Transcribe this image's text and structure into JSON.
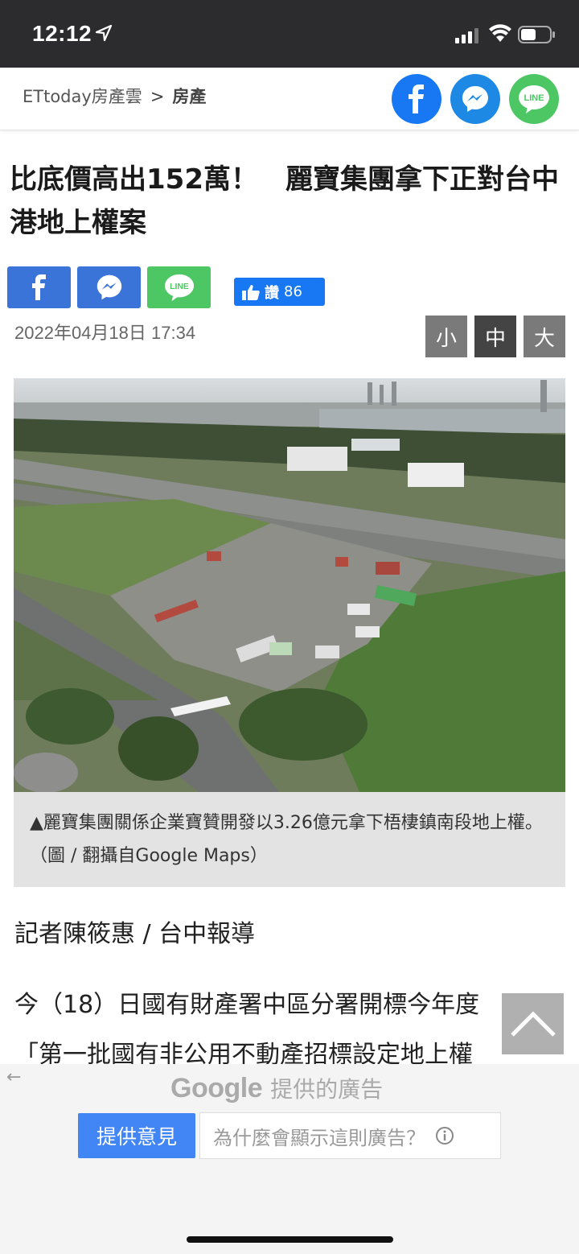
{
  "status_bar": {
    "time": "12:12"
  },
  "header": {
    "breadcrumb_site": "ETtoday房產雲",
    "breadcrumb_sep": ">",
    "breadcrumb_category": "房產",
    "share_icons": [
      "facebook-icon",
      "messenger-icon",
      "line-icon"
    ]
  },
  "article": {
    "title": "比底價高出152萬！　麗寶集團拿下正對台中港地上權案",
    "share_line_label": "LINE",
    "like_label": "讚",
    "like_count": "86",
    "date": "2022年04月18日 17:34",
    "font_sizes": [
      "小",
      "中",
      "大"
    ],
    "caption": "▲麗寶集團關係企業寶贊開發以3.26億元拿下梧棲鎮南段地上權。（圖 / 翻攝自Google Maps）",
    "reporter": "記者陳筱惠 / 台中報導",
    "paragraph_line1": "今（18）日國有財產署中區分署開標今年度",
    "paragraph_line2": "「第一批國有非公用不動產招標設定地上權"
  },
  "ad": {
    "back": "←",
    "brand": "Google",
    "provided_by": "提供的廣告",
    "feedback": "提供意見",
    "why": "為什麼會顯示這則廣告？"
  },
  "colors": {
    "facebook": "#1877f2",
    "messenger": "#1e88e5",
    "line": "#4cc764",
    "status_bar": "#2c2c2e"
  }
}
